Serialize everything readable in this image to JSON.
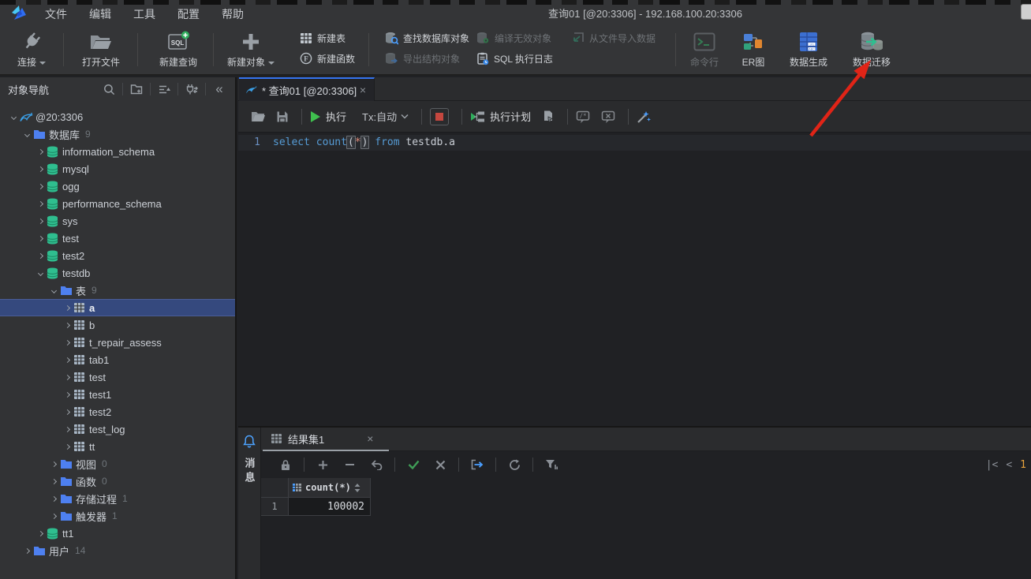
{
  "window": {
    "title": "查询01 [@20:3306]  - 192.168.100.20:3306",
    "menu": [
      "文件",
      "编辑",
      "工具",
      "配置",
      "帮助"
    ]
  },
  "toolbar": {
    "connect": "连接",
    "open_file": "打开文件",
    "new_query": "新建查询",
    "new_object": "新建对象",
    "new_table": "新建表",
    "new_function": "新建函数",
    "find_db_object": "查找数据库对象",
    "export_struct": "导出结构对象",
    "compile_invalid": "编译无效对象",
    "sql_log": "SQL 执行日志",
    "import_data": "从文件导入数据",
    "cmdline": "命令行",
    "er_diagram": "ER图",
    "data_generate": "数据生成",
    "data_migrate": "数据迁移"
  },
  "sidebar": {
    "title": "对象导航",
    "tree": [
      {
        "label": "@20:3306",
        "icon": "conn",
        "chev": "down",
        "level": 0
      },
      {
        "label": "数据库",
        "count": "9",
        "icon": "folder",
        "chev": "down",
        "level": 1
      },
      {
        "label": "information_schema",
        "icon": "db",
        "chev": "right",
        "level": 2
      },
      {
        "label": "mysql",
        "icon": "db",
        "chev": "right",
        "level": 2
      },
      {
        "label": "ogg",
        "icon": "db",
        "chev": "right",
        "level": 2
      },
      {
        "label": "performance_schema",
        "icon": "db",
        "chev": "right",
        "level": 2
      },
      {
        "label": "sys",
        "icon": "db",
        "chev": "right",
        "level": 2
      },
      {
        "label": "test",
        "icon": "db",
        "chev": "right",
        "level": 2
      },
      {
        "label": "test2",
        "icon": "db",
        "chev": "right",
        "level": 2
      },
      {
        "label": "testdb",
        "icon": "db",
        "chev": "down",
        "level": 2
      },
      {
        "label": "表",
        "count": "9",
        "icon": "folder",
        "chev": "down",
        "level": 3
      },
      {
        "label": "a",
        "icon": "table",
        "chev": "right",
        "level": 4,
        "selected": true
      },
      {
        "label": "b",
        "icon": "table",
        "chev": "right",
        "level": 4
      },
      {
        "label": "t_repair_assess",
        "icon": "table",
        "chev": "right",
        "level": 4
      },
      {
        "label": "tab1",
        "icon": "table",
        "chev": "right",
        "level": 4
      },
      {
        "label": "test",
        "icon": "table",
        "chev": "right",
        "level": 4
      },
      {
        "label": "test1",
        "icon": "table",
        "chev": "right",
        "level": 4
      },
      {
        "label": "test2",
        "icon": "table",
        "chev": "right",
        "level": 4
      },
      {
        "label": "test_log",
        "icon": "table",
        "chev": "right",
        "level": 4
      },
      {
        "label": "tt",
        "icon": "table",
        "chev": "right",
        "level": 4
      },
      {
        "label": "视图",
        "count": "0",
        "icon": "folder",
        "chev": "right",
        "level": 3
      },
      {
        "label": "函数",
        "count": "0",
        "icon": "folder",
        "chev": "right",
        "level": 3
      },
      {
        "label": "存储过程",
        "count": "1",
        "icon": "folder",
        "chev": "right",
        "level": 3
      },
      {
        "label": "触发器",
        "count": "1",
        "icon": "folder",
        "chev": "right",
        "level": 3
      },
      {
        "label": "tt1",
        "icon": "db",
        "chev": "right",
        "level": 2
      },
      {
        "label": "用户",
        "count": "14",
        "icon": "folder",
        "chev": "right",
        "level": 1
      }
    ]
  },
  "editor": {
    "tab_label": "* 查询01 [@20:3306]",
    "close": "×",
    "run_label": "执行",
    "tx_label": "Tx:自动",
    "plan_label": "执行计划",
    "line_number": "1",
    "sql_tokens": [
      "select",
      "count",
      "(",
      "*",
      ")",
      "from",
      "testdb.a"
    ]
  },
  "results": {
    "messages_label": "消息",
    "tab_label": "结果集1",
    "close": "×",
    "column_header": "count(*)",
    "row_number": "1",
    "value": "100002",
    "pager_first": "|<",
    "pager_prev": "<",
    "page": "1"
  },
  "colors": {
    "accent_blue": "#3574f0",
    "selection_blue": "#35497e",
    "db_green": "#2fbe8f",
    "folder_blue": "#4e80f0",
    "keyword_blue": "#569cd6",
    "run_green": "#3fbf4e",
    "arrow_red": "#e02417",
    "page_orange": "#e8a33d"
  }
}
